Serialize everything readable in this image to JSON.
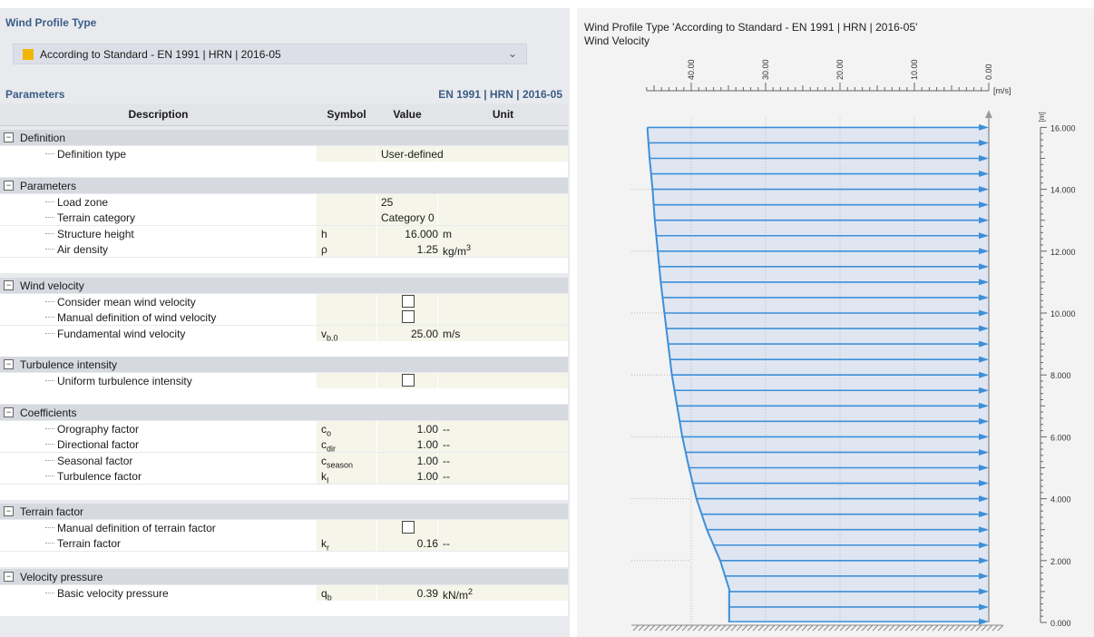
{
  "wind_profile": {
    "section_title": "Wind Profile Type",
    "selected": "According to Standard - EN 1991 | HRN | 2016-05",
    "swatch_color": "#f2b705"
  },
  "parameters": {
    "title": "Parameters",
    "standard": "EN 1991 | HRN | 2016-05",
    "columns": [
      "Description",
      "Symbol",
      "Value",
      "Unit"
    ],
    "groups": {
      "definition": {
        "label": "Definition",
        "items": {
          "definition_type": {
            "label": "Definition type",
            "value": "User-defined"
          }
        }
      },
      "parameters": {
        "label": "Parameters",
        "items": {
          "load_zone": {
            "label": "Load zone",
            "value": "25"
          },
          "terrain_category": {
            "label": "Terrain category",
            "value": "Category 0"
          },
          "structure_height": {
            "label": "Structure height",
            "symbol": "h",
            "value": "16.000",
            "unit": "m"
          },
          "air_density": {
            "label": "Air density",
            "symbol": "ρ",
            "value": "1.25",
            "unit": "kg/m",
            "unit_sup": "3"
          }
        }
      },
      "wind_velocity": {
        "label": "Wind velocity",
        "items": {
          "consider_mean": {
            "label": "Consider mean wind velocity",
            "checked": false
          },
          "manual_def": {
            "label": "Manual definition of wind velocity",
            "checked": false
          },
          "fundamental": {
            "label": "Fundamental wind velocity",
            "symbol": "v",
            "symbol_sub": "b,0",
            "value": "25.00",
            "unit": "m/s"
          }
        }
      },
      "turbulence": {
        "label": "Turbulence intensity",
        "items": {
          "uniform": {
            "label": "Uniform turbulence intensity",
            "checked": false
          }
        }
      },
      "coefficients": {
        "label": "Coefficients",
        "items": {
          "orography": {
            "label": "Orography factor",
            "symbol": "c",
            "symbol_sub": "o",
            "value": "1.00",
            "unit": "--"
          },
          "directional": {
            "label": "Directional factor",
            "symbol": "c",
            "symbol_sub": "dir",
            "value": "1.00",
            "unit": "--"
          },
          "seasonal": {
            "label": "Seasonal factor",
            "symbol": "c",
            "symbol_sub": "season",
            "value": "1.00",
            "unit": "--"
          },
          "turbulence_factor": {
            "label": "Turbulence factor",
            "symbol": "k",
            "symbol_sub": "I",
            "value": "1.00",
            "unit": "--"
          }
        }
      },
      "terrain_factor": {
        "label": "Terrain factor",
        "items": {
          "manual": {
            "label": "Manual definition of terrain factor",
            "checked": false
          },
          "terrain": {
            "label": "Terrain factor",
            "symbol": "k",
            "symbol_sub": "r",
            "value": "0.16",
            "unit": "--"
          }
        }
      },
      "velocity_pressure": {
        "label": "Velocity pressure",
        "items": {
          "basic": {
            "label": "Basic velocity pressure",
            "symbol": "q",
            "symbol_sub": "b",
            "value": "0.39",
            "unit": "kN/m",
            "unit_sup": "2"
          }
        }
      }
    },
    "toggle_symbol": "−"
  },
  "chart_title": "Wind Profile Type 'According to Standard - EN 1991 | HRN | 2016-05'",
  "chart_subtitle": "Wind Velocity",
  "chart_data": {
    "type": "line",
    "title": "Wind Profile Type 'According to Standard - EN 1991 | HRN | 2016-05'",
    "subtitle": "Wind Velocity",
    "x_unit": "[m/s]",
    "y_unit": "[m]",
    "x_ticks": [
      "40.00",
      "30.00",
      "20.00",
      "10.00",
      "0.00"
    ],
    "y_ticks": [
      "0.000",
      "2.000",
      "4.000",
      "6.000",
      "8.000",
      "10.000",
      "12.000",
      "14.000",
      "16.000"
    ],
    "xlim": [
      0,
      46
    ],
    "ylim": [
      0,
      16.5
    ],
    "x_reversed": true,
    "series": [
      {
        "color": "#3d8fd8",
        "profile": [
          {
            "z": 0.0,
            "v": 34.9
          },
          {
            "z": 1.0,
            "v": 34.9
          },
          {
            "z": 1.0,
            "v": 34.8
          },
          {
            "z": 2.0,
            "v": 36.1
          },
          {
            "z": 3.0,
            "v": 37.9
          },
          {
            "z": 4.0,
            "v": 39.3
          },
          {
            "z": 5.0,
            "v": 40.3
          },
          {
            "z": 6.0,
            "v": 41.2
          },
          {
            "z": 7.0,
            "v": 41.9
          },
          {
            "z": 8.0,
            "v": 42.6
          },
          {
            "z": 9.0,
            "v": 43.1
          },
          {
            "z": 10.0,
            "v": 43.6
          },
          {
            "z": 11.0,
            "v": 44.1
          },
          {
            "z": 12.0,
            "v": 44.5
          },
          {
            "z": 13.0,
            "v": 44.9
          },
          {
            "z": 14.0,
            "v": 45.2
          },
          {
            "z": 15.0,
            "v": 45.6
          },
          {
            "z": 16.0,
            "v": 45.9
          }
        ],
        "arrow_heights": [
          0.0,
          0.5,
          1.0,
          1.5,
          2.0,
          2.5,
          3.0,
          3.5,
          4.0,
          4.5,
          5.0,
          5.5,
          6.0,
          6.5,
          7.0,
          7.5,
          8.0,
          8.5,
          9.0,
          9.5,
          10.0,
          10.5,
          11.0,
          11.5,
          12.0,
          12.5,
          13.0,
          13.5,
          14.0,
          14.5,
          15.0,
          15.5,
          16.0
        ]
      }
    ]
  }
}
